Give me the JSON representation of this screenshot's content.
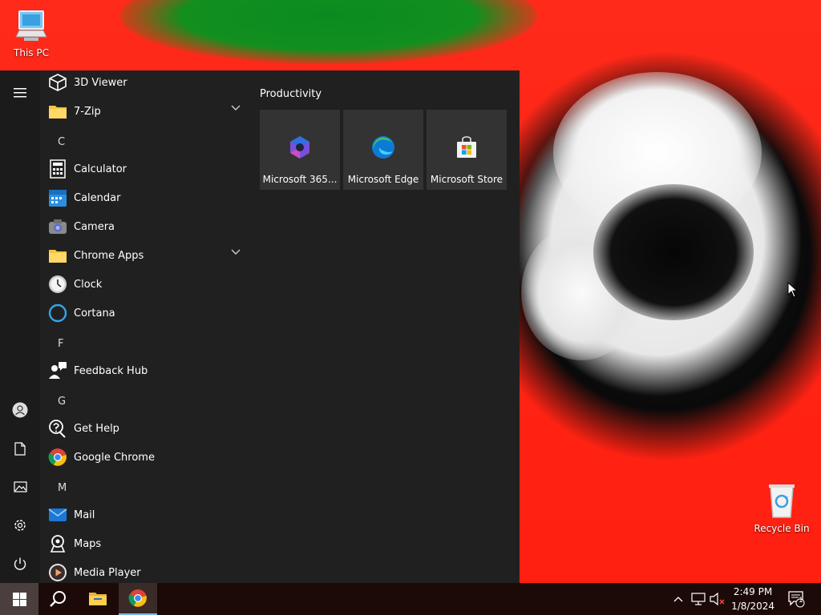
{
  "desktop": {
    "icons": [
      {
        "label": "This PC",
        "icon": "this-pc-icon"
      },
      {
        "label": "Recycle Bin",
        "icon": "recycle-bin-icon"
      }
    ]
  },
  "start_menu": {
    "app_list": [
      {
        "type": "app",
        "label": "3D Viewer",
        "icon": "3d-viewer-icon"
      },
      {
        "type": "folder",
        "label": "7-Zip",
        "icon": "folder-icon",
        "expandable": true
      },
      {
        "type": "letter",
        "label": "C"
      },
      {
        "type": "app",
        "label": "Calculator",
        "icon": "calculator-icon"
      },
      {
        "type": "app",
        "label": "Calendar",
        "icon": "calendar-icon"
      },
      {
        "type": "app",
        "label": "Camera",
        "icon": "camera-icon"
      },
      {
        "type": "folder",
        "label": "Chrome Apps",
        "icon": "folder-icon",
        "expandable": true
      },
      {
        "type": "app",
        "label": "Clock",
        "icon": "clock-icon"
      },
      {
        "type": "app",
        "label": "Cortana",
        "icon": "cortana-icon"
      },
      {
        "type": "letter",
        "label": "F"
      },
      {
        "type": "app",
        "label": "Feedback Hub",
        "icon": "feedback-hub-icon"
      },
      {
        "type": "letter",
        "label": "G"
      },
      {
        "type": "app",
        "label": "Get Help",
        "icon": "get-help-icon"
      },
      {
        "type": "app",
        "label": "Google Chrome",
        "icon": "chrome-icon"
      },
      {
        "type": "letter",
        "label": "M"
      },
      {
        "type": "app",
        "label": "Mail",
        "icon": "mail-icon"
      },
      {
        "type": "app",
        "label": "Maps",
        "icon": "maps-icon"
      },
      {
        "type": "app",
        "label": "Media Player",
        "icon": "media-player-icon"
      }
    ],
    "tile_group": {
      "title": "Productivity",
      "tiles": [
        {
          "label": "Microsoft 365...",
          "icon": "microsoft-365-icon"
        },
        {
          "label": "Microsoft Edge",
          "icon": "edge-icon"
        },
        {
          "label": "Microsoft Store",
          "icon": "store-icon"
        }
      ]
    },
    "rail": {
      "top": [
        "hamburger-icon"
      ],
      "bottom": [
        "user-icon",
        "documents-icon",
        "pictures-icon",
        "settings-icon",
        "power-icon"
      ]
    }
  },
  "taskbar": {
    "apps": [
      "start-icon",
      "search-icon",
      "file-explorer-icon",
      "chrome-icon"
    ],
    "tray": {
      "time": "2:49 PM",
      "date": "1/8/2024",
      "notification_count": "1"
    }
  },
  "colors": {
    "start_bg": "#202020",
    "rail_bg": "#1b1b1b",
    "tile_bg": "#333333",
    "taskbar_bg": "#1c0a08",
    "accent": "#4cc2ff",
    "wallpaper_red": "#ff2a1a"
  }
}
